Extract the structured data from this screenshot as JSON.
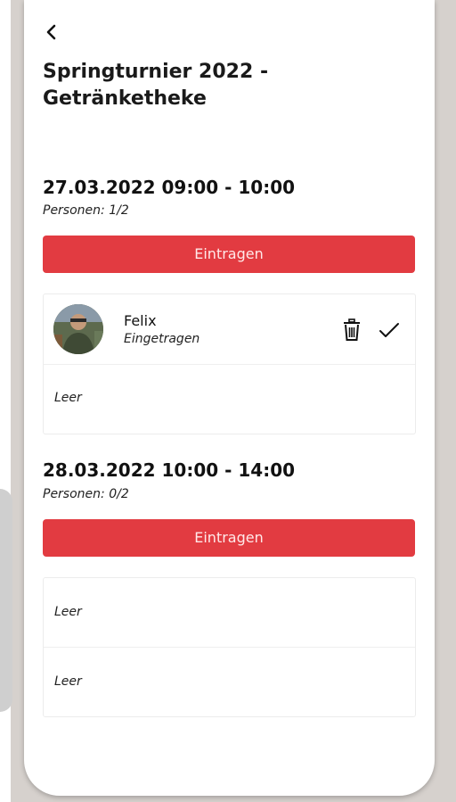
{
  "page": {
    "title": "Springturnier 2022 - Getränketheke"
  },
  "icons": {
    "back": "chevron-left-icon",
    "delete": "trash-icon",
    "confirm": "checkmark-icon"
  },
  "colors": {
    "accent": "#e23b41",
    "background": "#ffffff"
  },
  "slots": [
    {
      "time": "27.03.2022 09:00 - 10:00",
      "persons": "Personen: 1/2",
      "button_label": "Eintragen",
      "entries": [
        {
          "name": "Felix",
          "status": "Eingetragen"
        },
        {
          "empty_label": "Leer"
        }
      ]
    },
    {
      "time": "28.03.2022 10:00 - 14:00",
      "persons": "Personen: 0/2",
      "button_label": "Eintragen",
      "entries": [
        {
          "empty_label": "Leer"
        },
        {
          "empty_label": "Leer"
        }
      ]
    }
  ]
}
